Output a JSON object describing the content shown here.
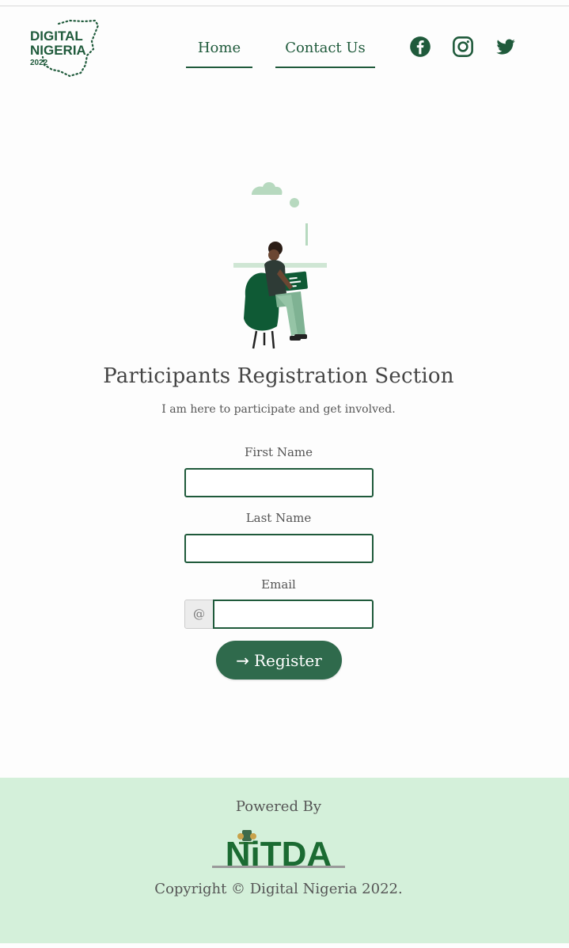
{
  "header": {
    "logo_text_line1": "DIGITAL",
    "logo_text_line2": "NIGERIA",
    "logo_text_line3": "2022",
    "nav": {
      "home": "Home",
      "contact": "Contact Us"
    },
    "social_icons": [
      "facebook-icon",
      "instagram-icon",
      "twitter-icon"
    ]
  },
  "main": {
    "title": "Participants Registration Section",
    "subtitle": "I am here to participate and get involved.",
    "form": {
      "first_name_label": "First Name",
      "first_name_value": "",
      "last_name_label": "Last Name",
      "last_name_value": "",
      "email_label": "Email",
      "email_prefix": "@",
      "email_value": "",
      "register_arrow": "→",
      "register_label": "Register"
    }
  },
  "footer": {
    "powered_by": "Powered By",
    "sponsor_logo_text": "NiTDA",
    "copyright": "Copyright © Digital Nigeria 2022."
  },
  "colors": {
    "brand_green": "#1f5a3b",
    "button_green": "#2f6a4c",
    "footer_bg": "#d4f0da"
  }
}
